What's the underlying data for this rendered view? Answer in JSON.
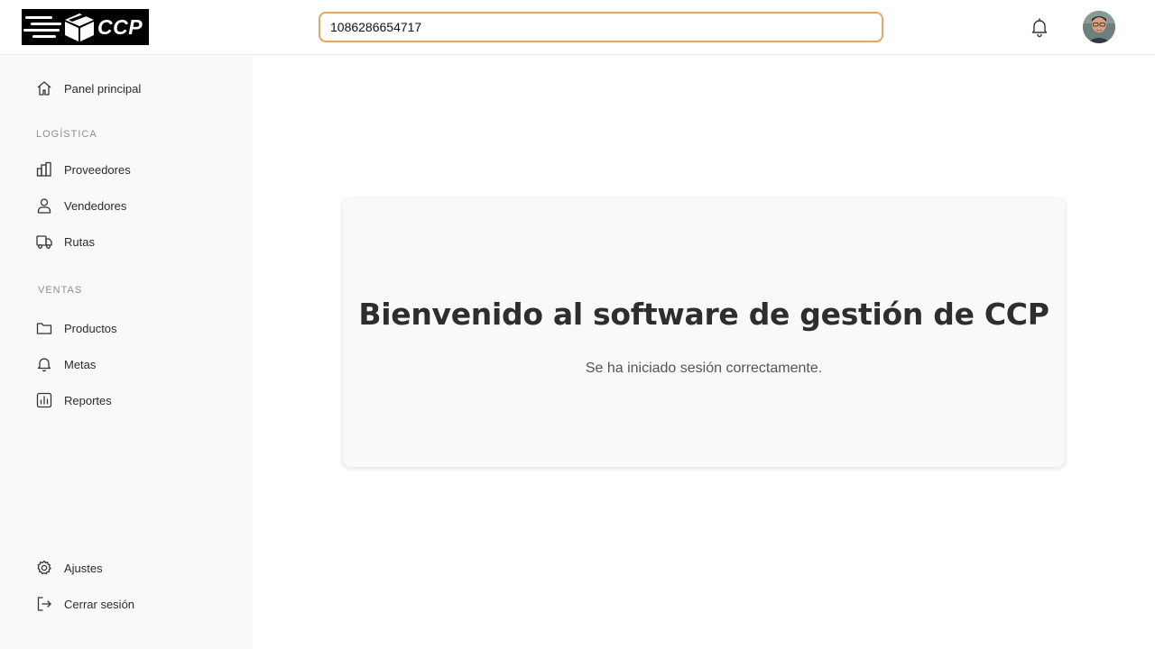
{
  "app": {
    "logo_text": "CCP",
    "colors": {
      "search_border": "#e3a663",
      "sidebar_bg": "#f9f9f9",
      "card_bg": "#f9f9f9"
    }
  },
  "header": {
    "search_value": "1086286654717",
    "notifications_icon": "bell-icon",
    "avatar_icon": "user-avatar"
  },
  "sidebar": {
    "home": {
      "label": "Panel principal",
      "icon": "home-icon"
    },
    "sections": [
      {
        "title": "LOGÍSTICA",
        "items": [
          {
            "label": "Proveedores",
            "icon": "building-icon"
          },
          {
            "label": "Vendedores",
            "icon": "user-icon"
          },
          {
            "label": "Rutas",
            "icon": "truck-icon"
          }
        ]
      },
      {
        "title": "VENTAS",
        "items": [
          {
            "label": "Productos",
            "icon": "folder-icon"
          },
          {
            "label": "Metas",
            "icon": "bell-icon"
          },
          {
            "label": "Reportes",
            "icon": "chart-icon"
          }
        ]
      }
    ],
    "footer": [
      {
        "label": "Ajustes",
        "icon": "gear-icon"
      },
      {
        "label": "Cerrar sesión",
        "icon": "logout-icon"
      }
    ]
  },
  "main": {
    "welcome_title": "Bienvenido al software de gestión de CCP",
    "welcome_subtitle": "Se ha iniciado sesión correctamente."
  }
}
